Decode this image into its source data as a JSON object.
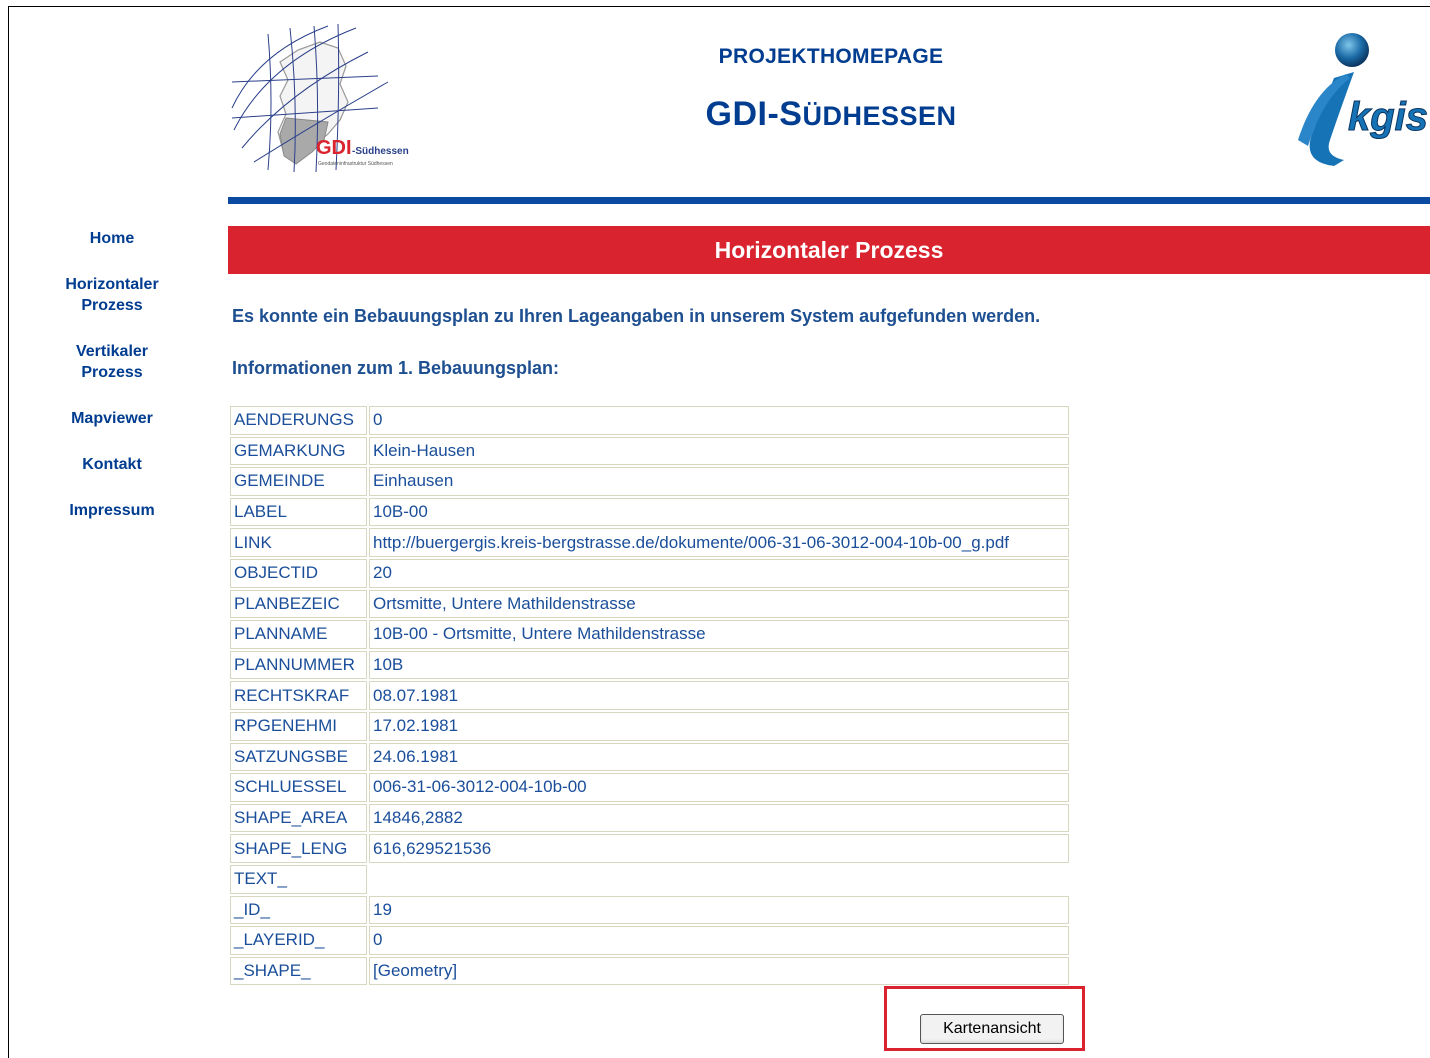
{
  "header": {
    "logo_left_text": "GDI",
    "logo_left_suffix": "-Südhessen",
    "logo_left_tagline": "Geodateninfrastruktur Südhessen",
    "subtitle": "PROJEKTHOMEPAGE",
    "title_main": "GDI-S",
    "title_rest": "ÜDHESSEN",
    "logo_right_text": "kgis"
  },
  "nav": {
    "items": [
      {
        "label": "Home"
      },
      {
        "label_line1": "Horizontaler",
        "label_line2": "Prozess"
      },
      {
        "label_line1": "Vertikaler",
        "label_line2": "Prozess"
      },
      {
        "label": "Mapviewer"
      },
      {
        "label": "Kontakt"
      },
      {
        "label": "Impressum"
      }
    ]
  },
  "section_title": "Horizontaler Prozess",
  "message": "Es konnte ein Bebauungsplan zu Ihren Lageangaben in unserem System aufgefunden werden.",
  "info_heading": "Informationen zum 1. Bebauungsplan:",
  "attributes": [
    {
      "key": "AENDERUNGS",
      "value": "0"
    },
    {
      "key": "GEMARKUNG",
      "value": "Klein-Hausen"
    },
    {
      "key": "GEMEINDE",
      "value": "Einhausen"
    },
    {
      "key": "LABEL",
      "value": "10B-00"
    },
    {
      "key": "LINK",
      "value": "http://buergergis.kreis-bergstrasse.de/dokumente/006-31-06-3012-004-10b-00_g.pdf"
    },
    {
      "key": "OBJECTID",
      "value": "20"
    },
    {
      "key": "PLANBEZEIC",
      "value": "Ortsmitte, Untere Mathildenstrasse"
    },
    {
      "key": "PLANNAME",
      "value": "10B-00 - Ortsmitte, Untere Mathildenstrasse"
    },
    {
      "key": "PLANNUMMER",
      "value": "10B"
    },
    {
      "key": "RECHTSKRAF",
      "value": "08.07.1981"
    },
    {
      "key": "RPGENEHMI",
      "value": "17.02.1981"
    },
    {
      "key": "SATZUNGSBE",
      "value": "24.06.1981"
    },
    {
      "key": "SCHLUESSEL",
      "value": "006-31-06-3012-004-10b-00"
    },
    {
      "key": "SHAPE_AREA",
      "value": "14846,2882"
    },
    {
      "key": "SHAPE_LENG",
      "value": "616,629521536"
    },
    {
      "key": "TEXT_",
      "value": ""
    },
    {
      "key": "_ID_",
      "value": "19"
    },
    {
      "key": "_LAYERID_",
      "value": "0"
    },
    {
      "key": "_SHAPE_",
      "value": "[Geometry]"
    }
  ],
  "button_label": "Kartenansicht",
  "colors": {
    "brand_blue": "#0a4aa0",
    "accent_red": "#d9232e"
  }
}
